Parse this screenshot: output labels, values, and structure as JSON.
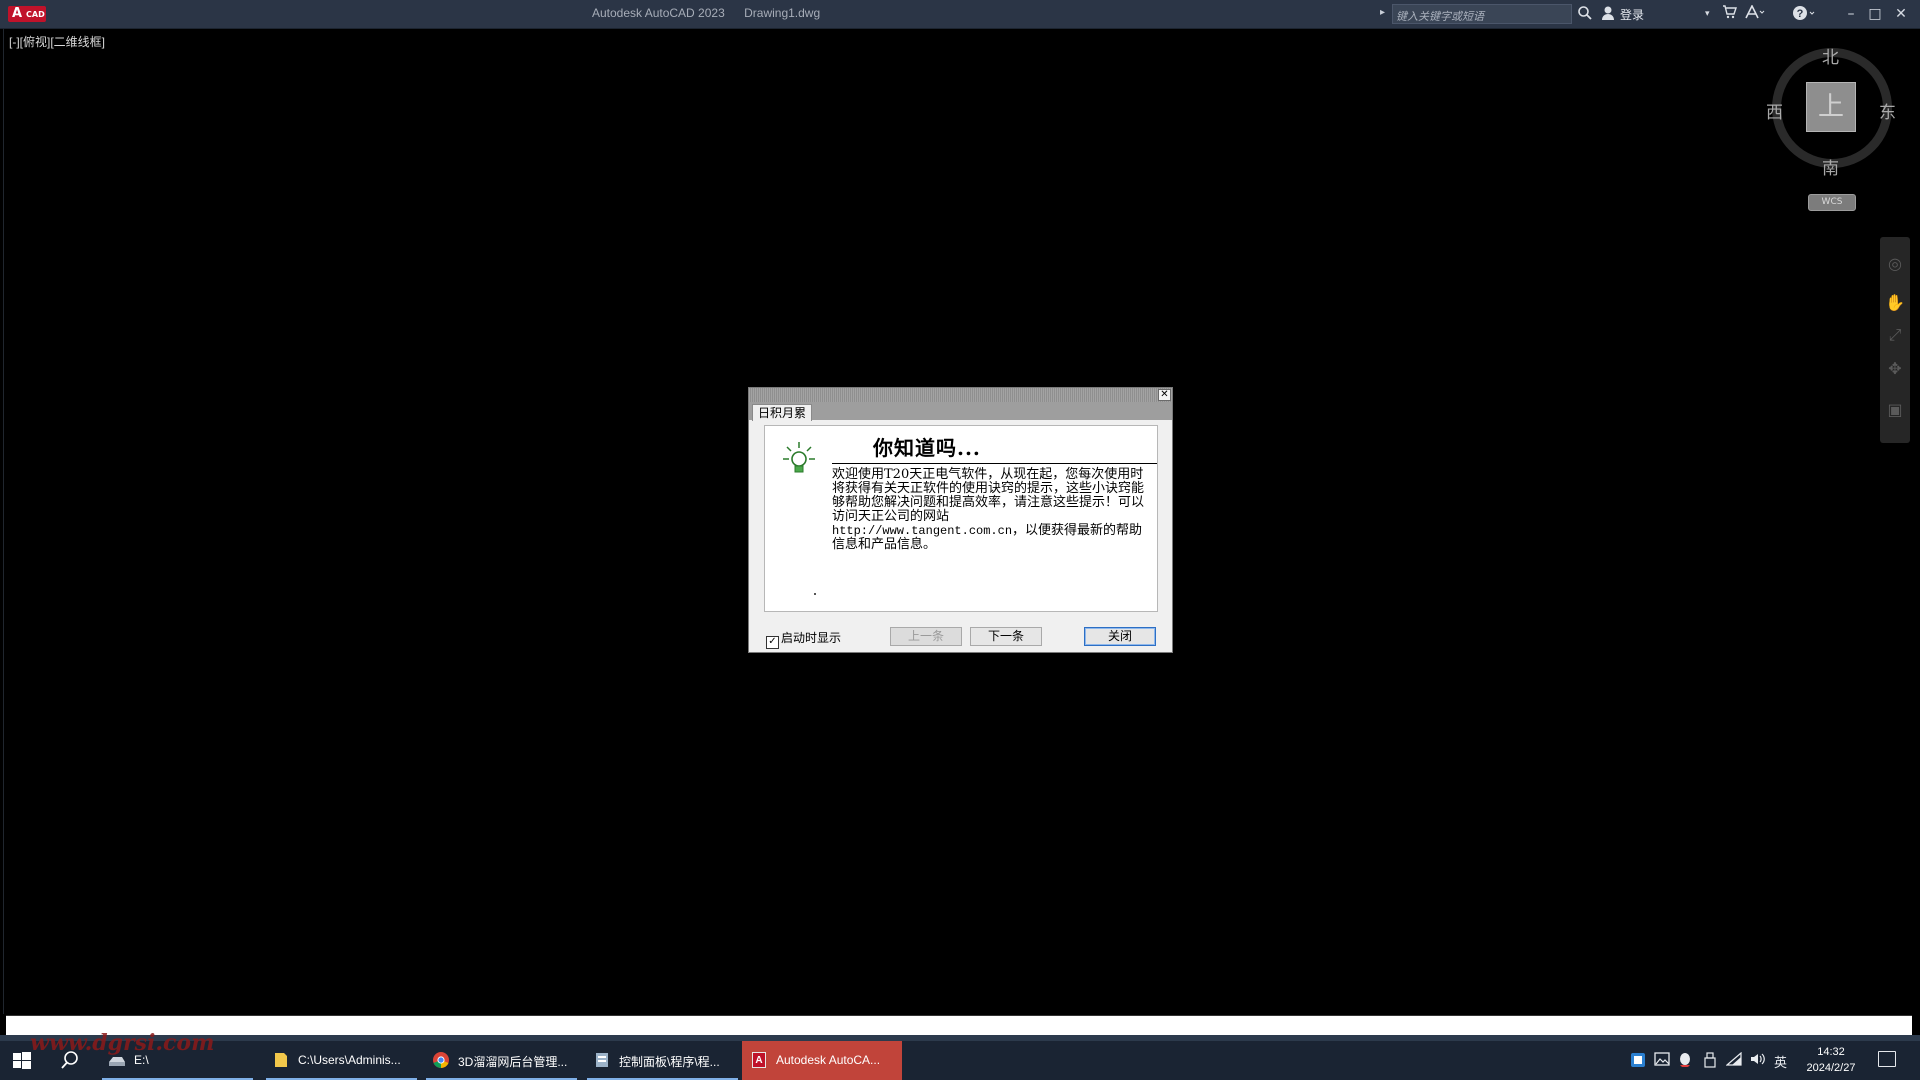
{
  "titlebar": {
    "app_logo": "A CAD",
    "app_name": "Autodesk AutoCAD 2023",
    "document": "Drawing1.dwg",
    "search_placeholder": "键入关键字或短语",
    "login": "登录",
    "colors": {
      "bar": "#2b3546",
      "logo": "#c0122a"
    }
  },
  "viewport": {
    "label": "[-][俯视][二维线框]"
  },
  "viewcube": {
    "top": "上",
    "north": "北",
    "south": "南",
    "east": "东",
    "west": "西",
    "wcs": "WCS"
  },
  "navbar": {
    "icons": [
      "steeringwheel-icon",
      "pan-icon",
      "zoom-icon",
      "orbit-icon",
      "showmotion-icon"
    ]
  },
  "dialog": {
    "tab": "日积月累",
    "heading": "你知道吗...",
    "body_text": "欢迎使用T20天正电气软件，从现在起，您每次使用时将获得有关天正软件的使用诀窍的提示，这些小诀窍能够帮助您解决问题和提高效率，请注意这些提示！可以访问天正公司的网站",
    "url": "http://www.tangent.com.cn",
    "body_tail": "，以便获得最新的帮助信息和产品信息。",
    "checkbox_label": "启动时显示",
    "checkbox_checked": true,
    "prev_button": "上一条",
    "next_button": "下一条",
    "close_button": "关闭"
  },
  "taskbar": {
    "tasks": [
      {
        "label": "E:\\",
        "icon": "drive-icon"
      },
      {
        "label": "C:\\Users\\Adminis...",
        "icon": "folder-icon"
      },
      {
        "label": "3D溜溜网后台管理...",
        "icon": "chrome-icon"
      },
      {
        "label": "控制面板\\程序\\程...",
        "icon": "control-panel-icon"
      },
      {
        "label": "Autodesk AutoCA...",
        "icon": "autocad-icon",
        "active": true
      }
    ],
    "ime": "英",
    "time": "14:32",
    "date": "2024/2/27",
    "active_color": "#c1443a"
  },
  "watermark": "www.dgrsi.com"
}
